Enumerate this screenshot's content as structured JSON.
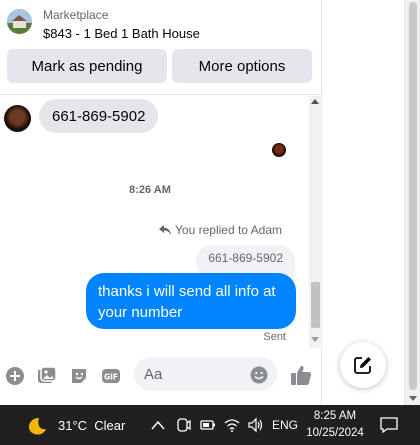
{
  "header": {
    "subtitle": "Marketplace",
    "title": "$843 - 1 Bed 1 Bath House",
    "pending_label": "Mark as pending",
    "options_label": "More options"
  },
  "thread": {
    "incoming_message": "661-869-5902",
    "timestamp": "8:26 AM",
    "replied_label": "You replied to Adam",
    "quoted_message": "661-869-5902",
    "outgoing_message": "thanks i will send all info at your number",
    "status": "Sent"
  },
  "composer": {
    "placeholder": "Aa"
  },
  "taskbar": {
    "weather": "31°C  Clear",
    "language": "ENG",
    "time": "8:25 AM",
    "date": "10/25/2024"
  },
  "colors": {
    "accent": "#0084ff",
    "bubble_gray": "#e4e6eb",
    "taskbar": "#202020"
  },
  "icons": [
    "plus-circle-icon",
    "photo-icon",
    "sticker-icon",
    "gif-icon",
    "emoji-icon",
    "like-icon",
    "compose-icon",
    "weather-moon-icon",
    "chevron-up-icon",
    "meet-now-icon",
    "battery-icon",
    "wifi-icon",
    "volume-icon",
    "notification-icon"
  ]
}
